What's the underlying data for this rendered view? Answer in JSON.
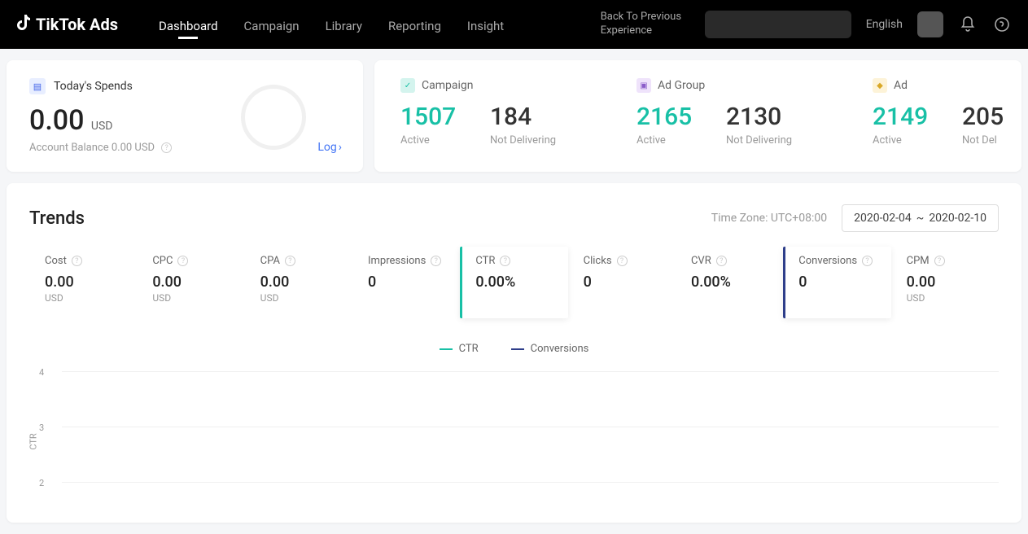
{
  "header": {
    "logo_text": "TikTok Ads",
    "nav": [
      "Dashboard",
      "Campaign",
      "Library",
      "Reporting",
      "Insight"
    ],
    "back_link": "Back To Previous Experience",
    "language": "English"
  },
  "spend": {
    "title": "Today's Spends",
    "amount": "0.00",
    "currency": "USD",
    "balance": "Account Balance 0.00 USD",
    "log": "Log"
  },
  "overview": {
    "levels": [
      {
        "name": "Campaign",
        "stats": [
          {
            "value": "1507",
            "label": "Active",
            "color": "teal"
          },
          {
            "value": "184",
            "label": "Not Delivering",
            "color": "dark"
          }
        ]
      },
      {
        "name": "Ad Group",
        "stats": [
          {
            "value": "2165",
            "label": "Active",
            "color": "teal"
          },
          {
            "value": "2130",
            "label": "Not Delivering",
            "color": "dark"
          }
        ]
      },
      {
        "name": "Ad",
        "stats": [
          {
            "value": "2149",
            "label": "Active",
            "color": "teal"
          },
          {
            "value": "205",
            "label": "Not Del",
            "color": "dark"
          }
        ]
      }
    ]
  },
  "trends": {
    "title": "Trends",
    "timezone": "Time Zone: UTC+08:00",
    "date_from": "2020-02-04",
    "date_to": "2020-02-10",
    "metrics": [
      {
        "label": "Cost",
        "value": "0.00",
        "sub": "USD",
        "selected": false
      },
      {
        "label": "CPC",
        "value": "0.00",
        "sub": "USD",
        "selected": false
      },
      {
        "label": "CPA",
        "value": "0.00",
        "sub": "USD",
        "selected": false
      },
      {
        "label": "Impressions",
        "value": "0",
        "sub": "",
        "selected": false
      },
      {
        "label": "CTR",
        "value": "0.00%",
        "sub": "",
        "selected": true,
        "color": "teal"
      },
      {
        "label": "Clicks",
        "value": "0",
        "sub": "",
        "selected": false
      },
      {
        "label": "CVR",
        "value": "0.00%",
        "sub": "",
        "selected": false
      },
      {
        "label": "Conversions",
        "value": "0",
        "sub": "",
        "selected": true,
        "color": "navy"
      },
      {
        "label": "CPM",
        "value": "0.00",
        "sub": "USD",
        "selected": false
      }
    ],
    "legend": [
      {
        "label": "CTR",
        "color": "#18c0a6"
      },
      {
        "label": "Conversions",
        "color": "#2e3e8a"
      }
    ]
  },
  "chart_data": {
    "type": "line",
    "title": "Trends",
    "xlabel": "",
    "ylabel": "CTR",
    "ylim": [
      0,
      4
    ],
    "y_ticks": [
      2,
      3,
      4
    ],
    "x_range": [
      "2020-02-04",
      "2020-02-10"
    ],
    "series": [
      {
        "name": "CTR",
        "color": "#18c0a6",
        "values": []
      },
      {
        "name": "Conversions",
        "color": "#2e3e8a",
        "values": []
      }
    ]
  }
}
